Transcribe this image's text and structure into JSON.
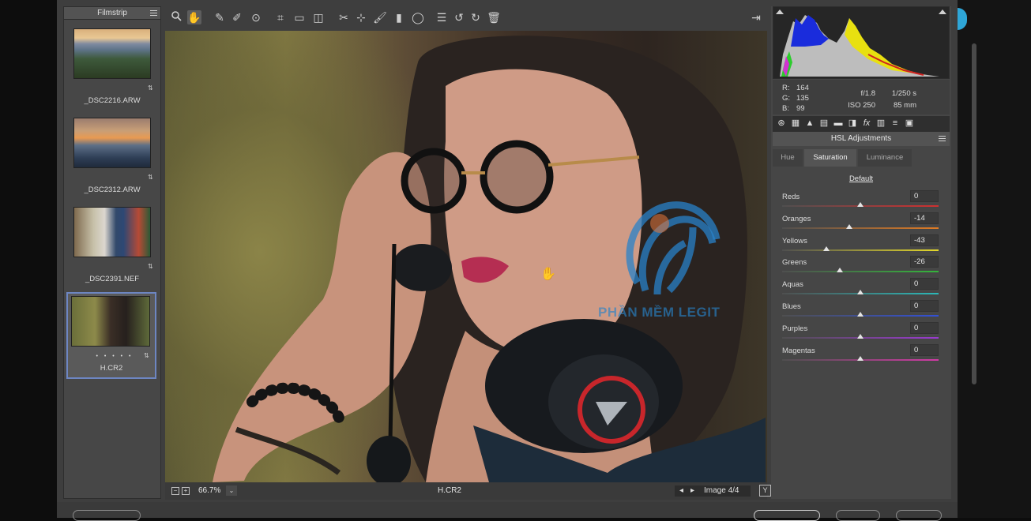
{
  "filmstrip": {
    "title": "Filmstrip",
    "items": [
      {
        "name": "_DSC2216.ARW"
      },
      {
        "name": "_DSC2312.ARW"
      },
      {
        "name": "_DSC2391.NEF"
      },
      {
        "name": "H.CR2",
        "stars": "• • • • •",
        "selected": true
      }
    ]
  },
  "toolbar": {
    "tools": [
      "zoom-tool",
      "hand-tool",
      "white-balance-tool",
      "color-sampler-tool",
      "targeted-adjustment-tool",
      "crop-tool",
      "straighten-tool",
      "transform-tool",
      "spot-removal-tool",
      "red-eye-removal-tool",
      "adjustment-brush",
      "graduated-filter",
      "radial-filter",
      "preferences",
      "rotate-ccw",
      "rotate-cw",
      "trash"
    ]
  },
  "status": {
    "zoom": "66.7%",
    "filename": "H.CR2",
    "image_counter": "Image 4/4"
  },
  "readout": {
    "r_label": "R:",
    "r": "164",
    "g_label": "G:",
    "g": "135",
    "b_label": "B:",
    "b": "99",
    "aperture": "f/1.8",
    "shutter": "1/250 s",
    "iso": "ISO 250",
    "focal": "85 mm"
  },
  "panel": {
    "title": "HSL Adjustments",
    "tabs": [
      "Hue",
      "Saturation",
      "Luminance"
    ],
    "active_tab": "Saturation",
    "default_label": "Default",
    "sliders": [
      {
        "label": "Reds",
        "value": "0",
        "num": 0,
        "colors": [
          "#4f4f4f",
          "#d03030"
        ]
      },
      {
        "label": "Oranges",
        "value": "-14",
        "num": -14,
        "colors": [
          "#4f4f4f",
          "#e07b23"
        ]
      },
      {
        "label": "Yellows",
        "value": "-43",
        "num": -43,
        "colors": [
          "#4f4f4f",
          "#e3d72a"
        ]
      },
      {
        "label": "Greens",
        "value": "-26",
        "num": -26,
        "colors": [
          "#4f4f4f",
          "#34b53b"
        ]
      },
      {
        "label": "Aquas",
        "value": "0",
        "num": 0,
        "colors": [
          "#4f4f4f",
          "#2bb8b8"
        ]
      },
      {
        "label": "Blues",
        "value": "0",
        "num": 0,
        "colors": [
          "#4f4f4f",
          "#3250d6"
        ]
      },
      {
        "label": "Purples",
        "value": "0",
        "num": 0,
        "colors": [
          "#4f4f4f",
          "#9a3ad0"
        ]
      },
      {
        "label": "Magentas",
        "value": "0",
        "num": 0,
        "colors": [
          "#4f4f4f",
          "#d23aa6"
        ]
      }
    ]
  },
  "watermark": {
    "text": "PHẦN MỀM LEGIT"
  },
  "colors": {
    "accent": "#6d86c2",
    "panel_bg": "#464646"
  }
}
